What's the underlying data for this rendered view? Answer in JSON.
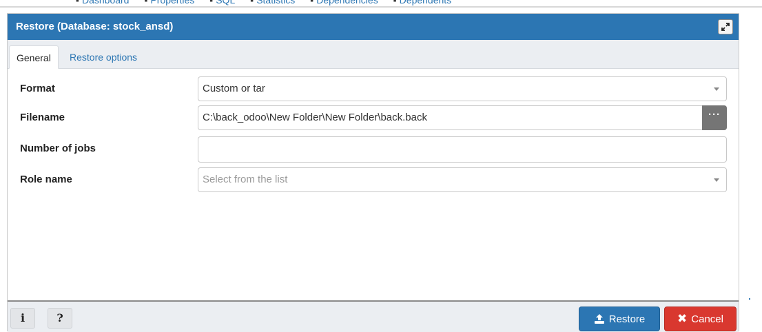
{
  "background": {
    "tabs": [
      {
        "icon": "dashboard-icon",
        "label": "Dashboard"
      },
      {
        "icon": "properties-icon",
        "label": "Properties"
      },
      {
        "icon": "sql-icon",
        "label": "SQL"
      },
      {
        "icon": "statistics-icon",
        "label": "Statistics"
      },
      {
        "icon": "dependencies-icon",
        "label": "Dependencies"
      },
      {
        "icon": "dependents-icon",
        "label": "Dependents"
      }
    ]
  },
  "dialog": {
    "title": "Restore (Database: stock_ansd)",
    "tabs": [
      "General",
      "Restore options"
    ],
    "fields": {
      "format": {
        "label": "Format",
        "value": "Custom or tar"
      },
      "filename": {
        "label": "Filename",
        "value": "C:\\back_odoo\\New Folder\\New Folder\\back.back",
        "browse_label": "···"
      },
      "jobs": {
        "label": "Number of jobs",
        "value": ""
      },
      "role": {
        "label": "Role name",
        "placeholder": "Select from the list"
      }
    },
    "footer": {
      "info_label": "i",
      "help_label": "?",
      "restore_label": "Restore",
      "cancel_label": "Cancel",
      "cancel_icon": "✖"
    }
  },
  "colors": {
    "accent": "#2c76b3",
    "danger": "#d9382f",
    "panel": "#ebeef2"
  }
}
